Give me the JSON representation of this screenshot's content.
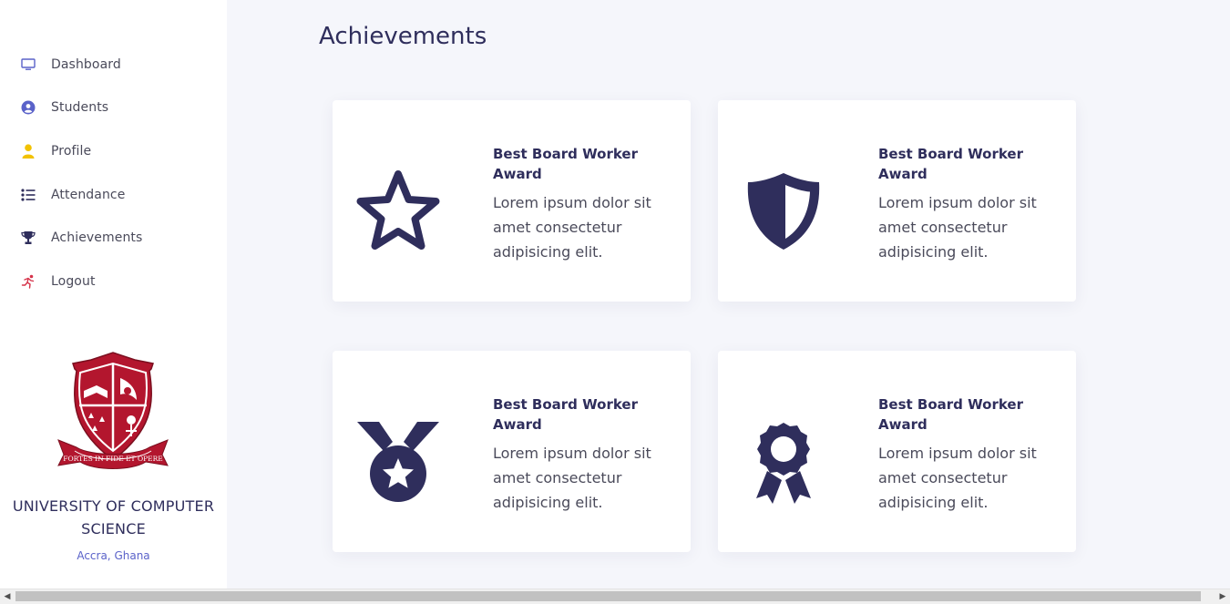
{
  "sidebar": {
    "items": [
      {
        "label": "Dashboard",
        "icon": "monitor-icon",
        "color": "#5a62c9"
      },
      {
        "label": "Students",
        "icon": "user-circle-icon",
        "color": "#5a62c9"
      },
      {
        "label": "Profile",
        "icon": "user-icon",
        "color": "#f2c200"
      },
      {
        "label": "Attendance",
        "icon": "list-icon",
        "color": "#2f2e5c"
      },
      {
        "label": "Achievements",
        "icon": "trophy-icon",
        "color": "#2f2e5c"
      },
      {
        "label": "Logout",
        "icon": "running-icon",
        "color": "#d6334a"
      }
    ],
    "university": {
      "name": "UNIVERSITY OF COMPUTER SCIENCE",
      "location": "Accra, Ghana",
      "motto": "FORTES IN FIDE ET OPERE"
    }
  },
  "main": {
    "title": "Achievements",
    "cards": [
      {
        "icon": "star-icon",
        "title": "Best Board Worker Award",
        "description": "Lorem ipsum dolor sit amet consectetur adipisicing elit."
      },
      {
        "icon": "shield-icon",
        "title": "Best Board Worker Award",
        "description": "Lorem ipsum dolor sit amet consectetur adipisicing elit."
      },
      {
        "icon": "medal-icon",
        "title": "Best Board Worker Award",
        "description": "Lorem ipsum dolor sit amet consectetur adipisicing elit."
      },
      {
        "icon": "award-ribbon-icon",
        "title": "Best Board Worker Award",
        "description": "Lorem ipsum dolor sit amet consectetur adipisicing elit."
      }
    ]
  },
  "colors": {
    "accent": "#2f2e5c",
    "background": "#f5f6fb",
    "crest_red": "#b3162e"
  }
}
